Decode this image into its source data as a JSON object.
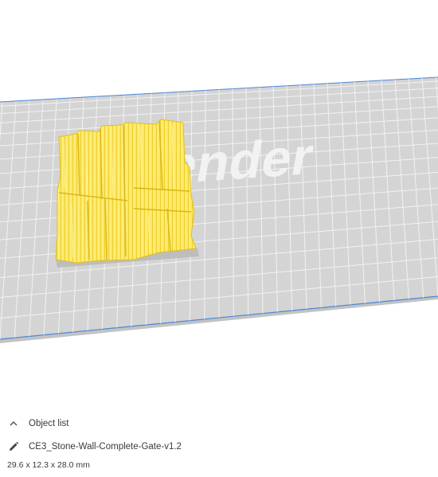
{
  "bed_logo_text": "ender",
  "object_list": {
    "header_label": "Object list",
    "object_name": "CE3_Stone-Wall-Complete-Gate-v1.2",
    "dimensions": "29.6 x 12.3 x 28.0 mm"
  },
  "icons": {
    "collapse": "chevron-up-icon",
    "edit": "pencil-icon"
  },
  "colors": {
    "model": "#ffe75a",
    "bed": "#d4d4d4",
    "grid": "#f2f2f2",
    "bed_edge": "#4a86d8",
    "text": "#3a3a3a"
  }
}
